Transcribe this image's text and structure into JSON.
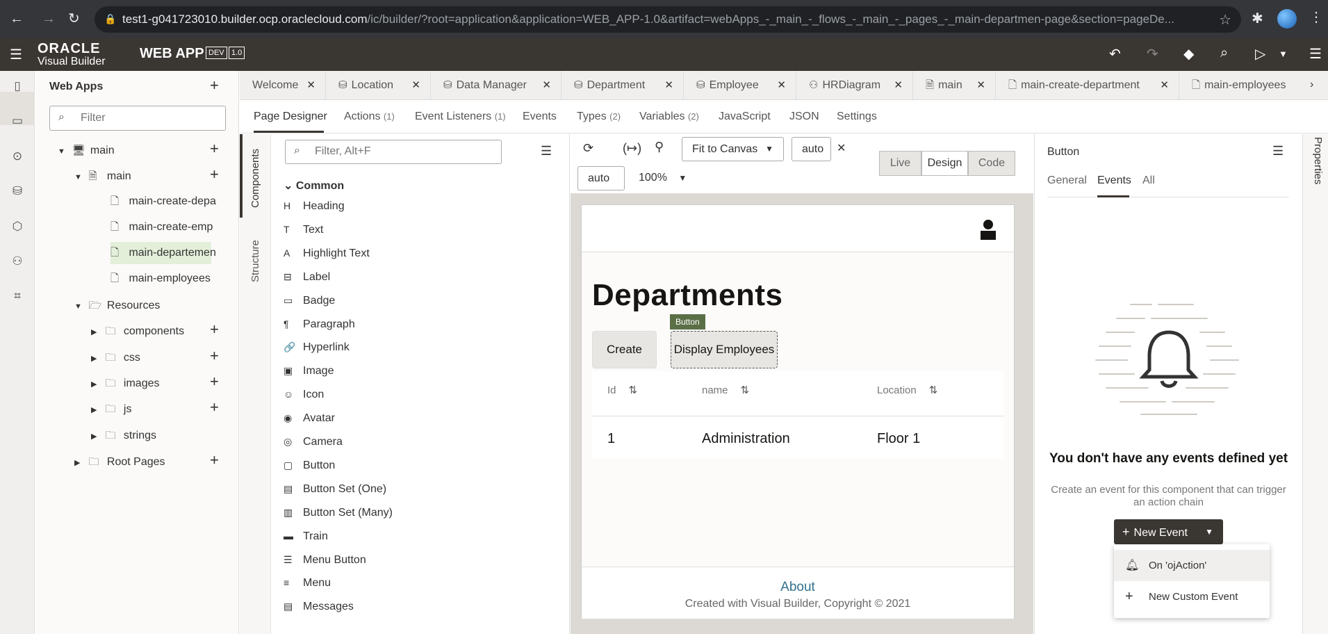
{
  "browser": {
    "url_main": "test1-g041723010.builder.ocp.oraclecloud.com",
    "url_rest": "/ic/builder/?root=application&application=WEB_APP-1.0&artifact=webApps_-_main_-_flows_-_main_-_pages_-_main-departmen-page&section=pageDe..."
  },
  "header": {
    "logo_top": "ORACLE",
    "logo_bottom": "Visual Builder",
    "app_name": "WEB APP",
    "badge_env": "DEV",
    "badge_version": "1.0"
  },
  "explorer": {
    "title": "Web Apps",
    "filter_placeholder": "Filter",
    "nodes": [
      {
        "label": "main"
      },
      {
        "label": "main"
      },
      {
        "label": "main-create-depa"
      },
      {
        "label": "main-create-emp"
      },
      {
        "label": "main-departemen"
      },
      {
        "label": "main-employees"
      },
      {
        "label": "Resources"
      },
      {
        "label": "components"
      },
      {
        "label": "css"
      },
      {
        "label": "images"
      },
      {
        "label": "js"
      },
      {
        "label": "strings"
      },
      {
        "label": "Root Pages"
      }
    ]
  },
  "tabs": [
    {
      "label": "Welcome"
    },
    {
      "label": "Location"
    },
    {
      "label": "Data Manager"
    },
    {
      "label": "Department"
    },
    {
      "label": "Employee"
    },
    {
      "label": "HRDiagram"
    },
    {
      "label": "main"
    },
    {
      "label": "main-create-department"
    },
    {
      "label": "main-employees"
    }
  ],
  "subtabs": [
    {
      "label": "Page Designer",
      "count": ""
    },
    {
      "label": "Actions",
      "count": "(1)"
    },
    {
      "label": "Event Listeners",
      "count": "(1)"
    },
    {
      "label": "Events",
      "count": ""
    },
    {
      "label": "Types",
      "count": "(2)"
    },
    {
      "label": "Variables",
      "count": "(2)"
    },
    {
      "label": "JavaScript",
      "count": ""
    },
    {
      "label": "JSON",
      "count": ""
    },
    {
      "label": "Settings",
      "count": ""
    }
  ],
  "side_tabs": {
    "components": "Components",
    "structure": "Structure",
    "properties": "Properties"
  },
  "palette": {
    "filter_placeholder": "Filter, Alt+F",
    "group": "Common",
    "items": [
      {
        "label": "Heading",
        "icon": "H"
      },
      {
        "label": "Text",
        "icon": "T"
      },
      {
        "label": "Highlight Text",
        "icon": "A"
      },
      {
        "label": "Label",
        "icon": "⊟"
      },
      {
        "label": "Badge",
        "icon": "▭"
      },
      {
        "label": "Paragraph",
        "icon": "¶"
      },
      {
        "label": "Hyperlink",
        "icon": "🔗"
      },
      {
        "label": "Image",
        "icon": "▣"
      },
      {
        "label": "Icon",
        "icon": "☺"
      },
      {
        "label": "Avatar",
        "icon": "◉"
      },
      {
        "label": "Camera",
        "icon": "◎"
      },
      {
        "label": "Button",
        "icon": "▢"
      },
      {
        "label": "Button Set (One)",
        "icon": "▤"
      },
      {
        "label": "Button Set (Many)",
        "icon": "▥"
      },
      {
        "label": "Train",
        "icon": "▬"
      },
      {
        "label": "Menu Button",
        "icon": "☰"
      },
      {
        "label": "Menu",
        "icon": "≡"
      },
      {
        "label": "Messages",
        "icon": "▤"
      }
    ]
  },
  "canvas_toolbar": {
    "fit": "Fit to Canvas",
    "width": "auto",
    "height": "auto",
    "zoom": "100%",
    "modes": [
      "Live",
      "Design",
      "Code"
    ]
  },
  "page": {
    "heading": "Departments",
    "create_button": "Create",
    "display_button": "Display Employees",
    "selected_tag": "Button",
    "columns": [
      "Id",
      "name",
      "Location"
    ],
    "rows": [
      [
        "1",
        "Administration",
        "Floor 1"
      ]
    ],
    "footer_link": "About",
    "footer_copy": "Created with Visual Builder, Copyright © 2021"
  },
  "properties": {
    "title": "Button",
    "tabs": [
      "General",
      "Events",
      "All"
    ],
    "empty_title": "You don't have any events defined yet",
    "empty_desc": "Create an event for this component that can trigger an action chain",
    "new_event": "New Event",
    "dropdown": [
      "On 'ojAction'",
      "New Custom Event"
    ]
  },
  "colors": {
    "header_bg": "#3a3632",
    "selected_node": "#e3efd9",
    "button_tag": "#5b6f46"
  }
}
